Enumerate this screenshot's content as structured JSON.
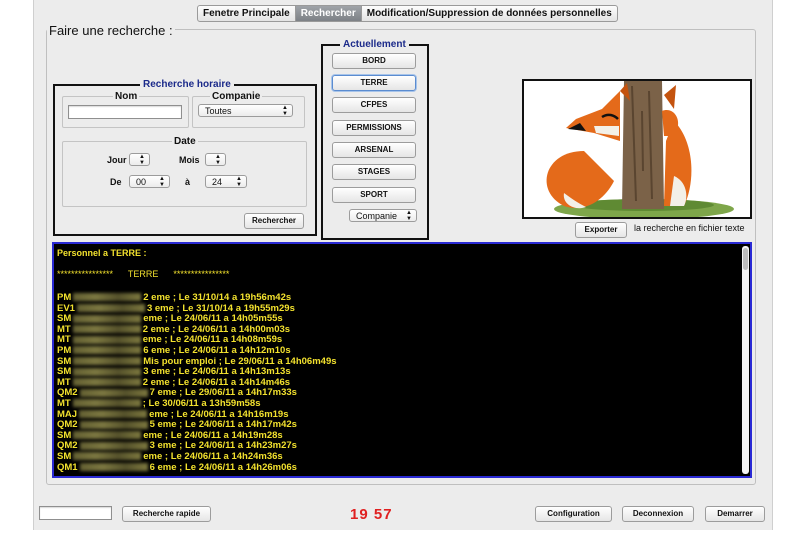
{
  "tabs": [
    "Fenetre Principale",
    "Rechercher",
    "Modification/Suppression de données personnelles"
  ],
  "group_title": "Faire une recherche :",
  "recherche_horaire": {
    "title": "Recherche horaire",
    "nom_label": "Nom",
    "nom_value": "",
    "companie_label": "Companie",
    "companie_value": "Toutes",
    "date_label": "Date",
    "jour_label": "Jour",
    "jour_value": "",
    "mois_label": "Mois",
    "mois_value": "",
    "de_label": "De",
    "de_value": "00",
    "a_label": "à",
    "a_value": "24",
    "search_button": "Rechercher"
  },
  "actuellement": {
    "title": "Actuellement",
    "buttons": [
      "BORD",
      "TERRE",
      "CFPES",
      "PERMISSIONS",
      "ARSENAL",
      "STAGES",
      "SPORT"
    ],
    "companie_select": "Companie"
  },
  "export": {
    "button": "Exporter",
    "label": "la recherche en fichier texte"
  },
  "log": {
    "header": "Personnel a TERRE :",
    "banner": "****************      TERRE      ****************",
    "lines": [
      {
        "prefix": "PM",
        "text": "2 eme ; Le 31/10/14 a 19h56m42s"
      },
      {
        "prefix": "EV1",
        "text": "3 eme ; Le 31/10/14 a 19h55m29s"
      },
      {
        "prefix": "SM",
        "text": "eme ; Le 24/06/11 a 14h05m55s"
      },
      {
        "prefix": "MT",
        "text": "2 eme ; Le 24/06/11 a 14h00m03s"
      },
      {
        "prefix": "MT",
        "text": "eme ; Le 24/06/11 a 14h08m59s"
      },
      {
        "prefix": "PM",
        "text": "6 eme ; Le 24/06/11 a 14h12m10s"
      },
      {
        "prefix": "SM",
        "text": "Mis pour emploi ; Le 29/06/11 a 14h06m49s"
      },
      {
        "prefix": "SM",
        "text": "3 eme ; Le 24/06/11 a 14h13m13s"
      },
      {
        "prefix": "MT",
        "text": "2 eme ; Le 24/06/11 a 14h14m46s"
      },
      {
        "prefix": "QM2",
        "text": "7 eme ; Le 29/06/11 a 14h17m33s"
      },
      {
        "prefix": "MT",
        "text": "; Le 30/06/11 a 13h59m58s"
      },
      {
        "prefix": "MAJ",
        "text": "eme ; Le 24/06/11 a 14h16m19s"
      },
      {
        "prefix": "QM2",
        "text": "5 eme ; Le 24/06/11 a 14h17m42s"
      },
      {
        "prefix": "SM",
        "text": "eme ; Le 24/06/11 a 14h19m28s"
      },
      {
        "prefix": "QM2",
        "text": "3 eme ; Le 24/06/11 a 14h23m27s"
      },
      {
        "prefix": "SM",
        "text": "eme ; Le 24/06/11 a 14h24m36s"
      },
      {
        "prefix": "QM1",
        "text": "6 eme ; Le 24/06/11 a 14h26m06s"
      }
    ]
  },
  "bottom": {
    "quick_search_value": "",
    "quick_search_button": "Recherche rapide",
    "clock": "19 57",
    "config_button": "Configuration",
    "logout_button": "Deconnexion",
    "start_button": "Demarrer"
  },
  "colors": {
    "log_text": "#f2e12e",
    "log_border": "#2a2ad4",
    "panel_title": "#1b2a8a",
    "clock": "#e02020"
  }
}
